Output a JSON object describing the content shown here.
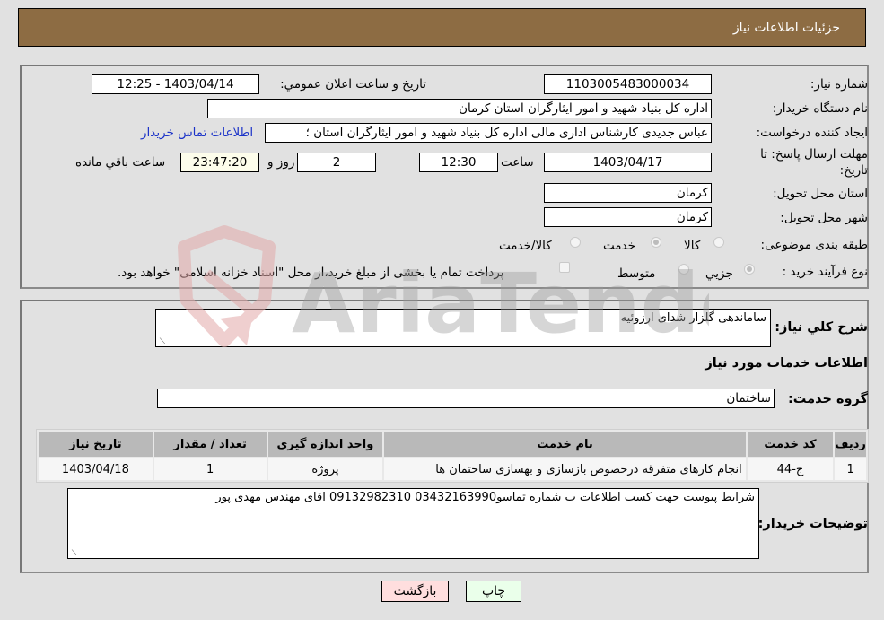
{
  "header": {
    "title": "جزئیات اطلاعات نیاز"
  },
  "form": {
    "need_number": {
      "label": "شماره نیاز:",
      "value": "1103005483000034"
    },
    "announce_datetime": {
      "label": "تاریخ و ساعت اعلان عمومي:",
      "value": "1403/04/14 - 12:25"
    },
    "buyer_org": {
      "label": "نام دستگاه خریدار:",
      "value": "اداره کل بنیاد شهید و امور ایثارگران استان کرمان"
    },
    "requester": {
      "label": "ایجاد کننده درخواست:",
      "value": "عباس جدیدی کارشناس اداری مالی اداره کل بنیاد شهید و امور ایثارگران استان ؛",
      "link": "اطلاعات تماس خریدار"
    },
    "deadline": {
      "label_line1": "مهلت ارسال پاسخ: تا",
      "label_line2": "تاریخ:",
      "date": "1403/04/17",
      "time_label": "ساعت",
      "time": "12:30",
      "days": "2",
      "days_label": "روز و",
      "remaining": "23:47:20",
      "remaining_label": "ساعت باقي مانده"
    },
    "province": {
      "label": "استان محل تحویل:",
      "value": "کرمان"
    },
    "city": {
      "label": "شهر محل تحویل:",
      "value": "کرمان"
    },
    "category": {
      "label": "طبقه بندی موضوعی:",
      "options": [
        {
          "label": "کالا",
          "checked": false
        },
        {
          "label": "خدمت",
          "checked": true
        },
        {
          "label": "کالا/خدمت",
          "checked": false
        }
      ]
    },
    "purchase_type": {
      "label": "نوع فرآیند خرید :",
      "options": [
        {
          "label": "جزیي",
          "checked": true
        },
        {
          "label": "متوسط",
          "checked": false
        }
      ],
      "treasury_note": "پرداخت تمام یا بخشی از مبلغ خرید،از محل \"اسناد خزانه اسلامی\" خواهد بود.",
      "treasury_checked": false
    }
  },
  "details": {
    "summary_label": "شرح کلي نیاز:",
    "summary_value": "ساماندهی گلزار شدای ارزوئیه",
    "services_title": "اطلاعات خدمات مورد نیاز",
    "service_group_label": "گروه خدمت:",
    "service_group_value": "ساختمان",
    "table": {
      "headers": [
        "ردیف",
        "کد خدمت",
        "نام خدمت",
        "واحد اندازه گیری",
        "تعداد / مقدار",
        "تاریخ نیاز"
      ],
      "rows": [
        [
          "1",
          "ج-44",
          "انجام کارهای متفرقه درخصوص بازسازی و بهسازی ساختمان ها",
          "پروژه",
          "1",
          "1403/04/18"
        ]
      ]
    },
    "buyer_notes_label": "توضیحات خریدار:",
    "buyer_notes_value": "شرایط پیوست جهت کسب اطلاعات ب شماره تماسو03432163990 09132982310 اقای مهندس مهدی پور"
  },
  "buttons": {
    "print": "چاپ",
    "back": "بازگشت"
  },
  "watermark": {
    "text": "AriaTender.neT"
  },
  "colors": {
    "header_bg": "#8d6c43",
    "link": "#1a32c8",
    "print_bg": "#eaffea",
    "back_bg": "#ffdede",
    "remaining_bg": "#fdfdeb"
  }
}
